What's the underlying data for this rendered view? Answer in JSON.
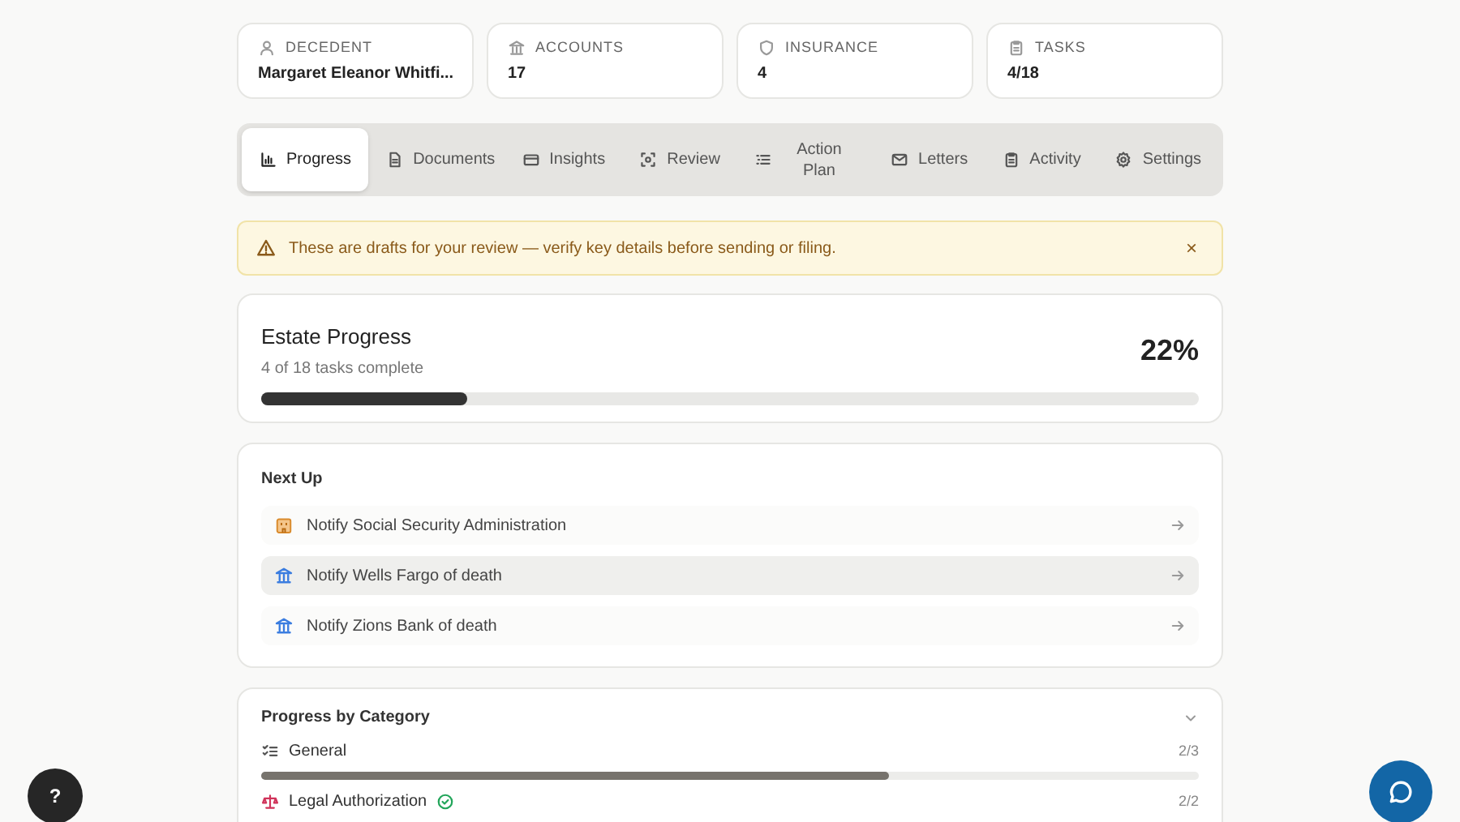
{
  "stats": [
    {
      "kind": "person",
      "label": "DECEDENT",
      "value": "Margaret Eleanor Whitfi..."
    },
    {
      "kind": "bank",
      "label": "ACCOUNTS",
      "value": "17"
    },
    {
      "kind": "shield",
      "label": "INSURANCE",
      "value": "4"
    },
    {
      "kind": "clipboard",
      "label": "TASKS",
      "value": "4/18"
    }
  ],
  "tabs": [
    {
      "kind": "chart",
      "label": "Progress",
      "selected": true
    },
    {
      "kind": "document",
      "label": "Documents",
      "selected": false
    },
    {
      "kind": "card",
      "label": "Insights",
      "selected": false
    },
    {
      "kind": "scan",
      "label": "Review",
      "selected": false
    },
    {
      "kind": "list",
      "label": "Action Plan",
      "selected": false
    },
    {
      "kind": "mail",
      "label": "Letters",
      "selected": false
    },
    {
      "kind": "clipboard",
      "label": "Activity",
      "selected": false
    },
    {
      "kind": "gear",
      "label": "Settings",
      "selected": false
    }
  ],
  "alert": {
    "text": "These are drafts for your review — verify key details before sending or filing.",
    "close": "×"
  },
  "estate_progress": {
    "title": "Estate Progress",
    "subtitle": "4 of 18 tasks complete",
    "percent": "22%",
    "level": 0.22
  },
  "next_up": {
    "title": "Next Up",
    "items": [
      {
        "kind": "building",
        "label": "Notify Social Security Administration",
        "selected": false
      },
      {
        "kind": "bank",
        "label": "Notify Wells Fargo of death",
        "selected": true
      },
      {
        "kind": "bank",
        "label": "Notify Zions Bank of death",
        "selected": false
      }
    ]
  },
  "categories": {
    "title": "Progress by Category",
    "expanded": true,
    "items": [
      {
        "kind": "checklist",
        "name": "General",
        "count": "2/3",
        "level": 0.67,
        "complete": false
      },
      {
        "kind": "scales",
        "name": "Legal Authorization",
        "count": "2/2",
        "complete": true
      }
    ]
  },
  "help_button": "?"
}
